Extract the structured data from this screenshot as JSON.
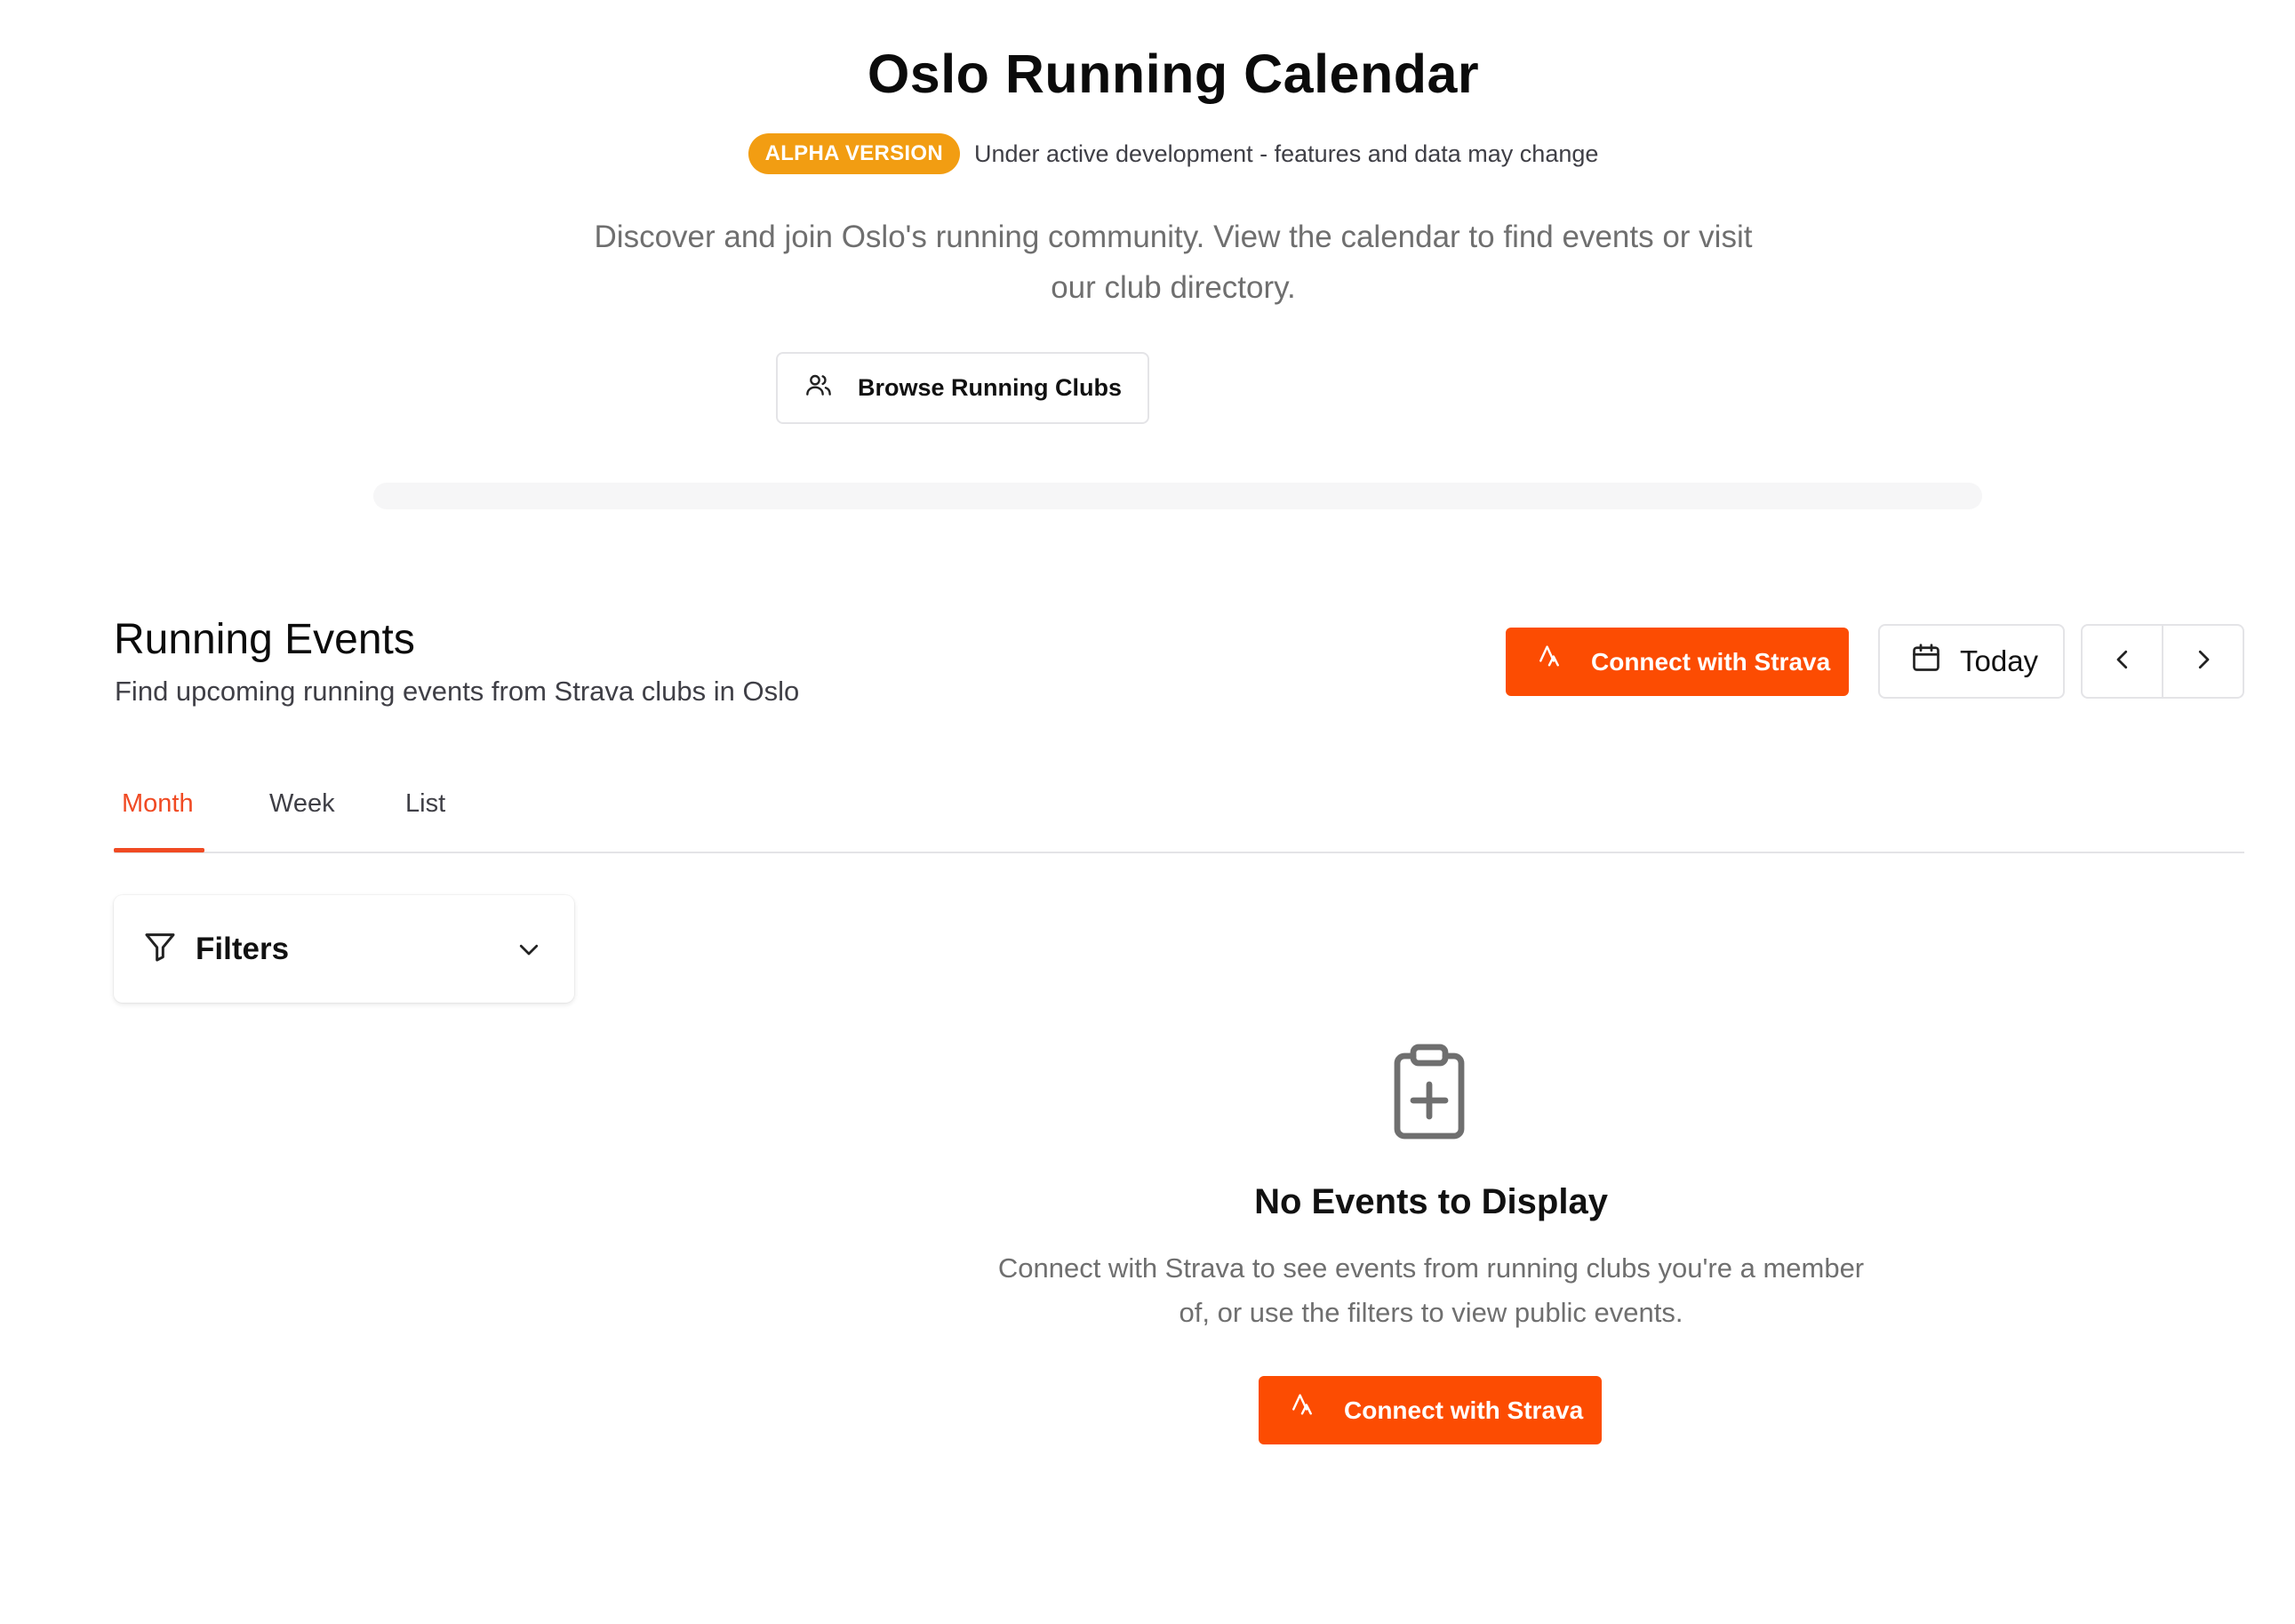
{
  "header": {
    "title": "Oslo Running Calendar",
    "badge": "ALPHA VERSION",
    "notice": "Under active development - features and data may change",
    "intro": "Discover and join Oslo's running community. View the calendar to find events or visit our club directory.",
    "browse_clubs_label": "Browse Running Clubs"
  },
  "events": {
    "title": "Running Events",
    "subtitle": "Find upcoming running events from Strava clubs in Oslo",
    "connect_label": "Connect with Strava",
    "today_label": "Today"
  },
  "tabs": [
    {
      "label": "Month",
      "active": true
    },
    {
      "label": "Week",
      "active": false
    },
    {
      "label": "List",
      "active": false
    }
  ],
  "filters": {
    "label": "Filters"
  },
  "empty_state": {
    "title": "No Events to Display",
    "description": "Connect with Strava to see events from running clubs you're a member of, or use the filters to view public events.",
    "connect_label": "Connect with Strava"
  },
  "icons": {
    "browse": "users-icon",
    "strava": "strava-icon",
    "today": "calendar-icon",
    "prev": "chevron-left-icon",
    "next": "chevron-right-icon",
    "filters": "filter-icon",
    "filters_toggle": "chevron-down-icon",
    "empty": "clipboard-plus-icon"
  },
  "colors": {
    "strava_orange": "#fc4c02",
    "badge": "#f29d12",
    "active_tab": "#f04a23"
  }
}
